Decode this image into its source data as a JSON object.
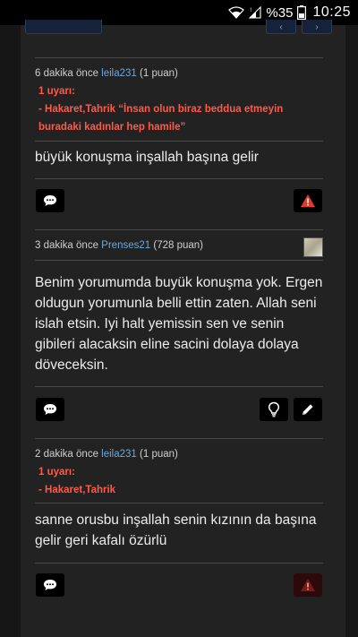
{
  "status_bar": {
    "battery_text": "%35",
    "time": "10:25",
    "icons": [
      "wifi-icon",
      "signal-icon",
      "battery-icon"
    ]
  },
  "top_nav": {
    "icons": [
      "chevron-left-icon",
      "chevron-right-icon"
    ]
  },
  "comments": [
    {
      "time_ago": "6 dakika önce",
      "username": "leila231",
      "points": "(1 puan)",
      "warning_count": "1 uyarı:",
      "warning_lines": [
        "- Hakaret,Tahrik “İnsan olun biraz beddua etmeyin",
        "buradaki kadınlar hep hamile”"
      ],
      "text": "büyük konuşma inşallah başına gelir",
      "actions": [
        "comment-icon",
        "flag-icon"
      ]
    },
    {
      "time_ago": "3 dakika önce",
      "username": "Prenses21",
      "points": "(728 puan)",
      "text": "Benim yorumumda buyük konuşma yok. Ergen oldugun yorumunla belli ettin zaten. Allah seni islah etsin. Iyi halt yemissin sen ve senin gibileri alacaksin eline sacini dolaya dolaya döveceksin.",
      "actions": [
        "comment-icon",
        "lightbulb-icon",
        "edit-icon"
      ]
    },
    {
      "time_ago": "2 dakika önce",
      "username": "leila231",
      "points": "(1 puan)",
      "warning_count": "1 uyarı:",
      "warning_lines": [
        "- Hakaret,Tahrik"
      ],
      "text": "sanne orusbu inşallah senin kızının da başına gelir geri kafalı özürlü",
      "actions": [
        "comment-icon",
        "flag-icon"
      ]
    }
  ],
  "colors": {
    "warning": "#ff5a48",
    "username": "#6fa8dc",
    "panel": "#222222",
    "flag_active": "#e03a2a"
  }
}
